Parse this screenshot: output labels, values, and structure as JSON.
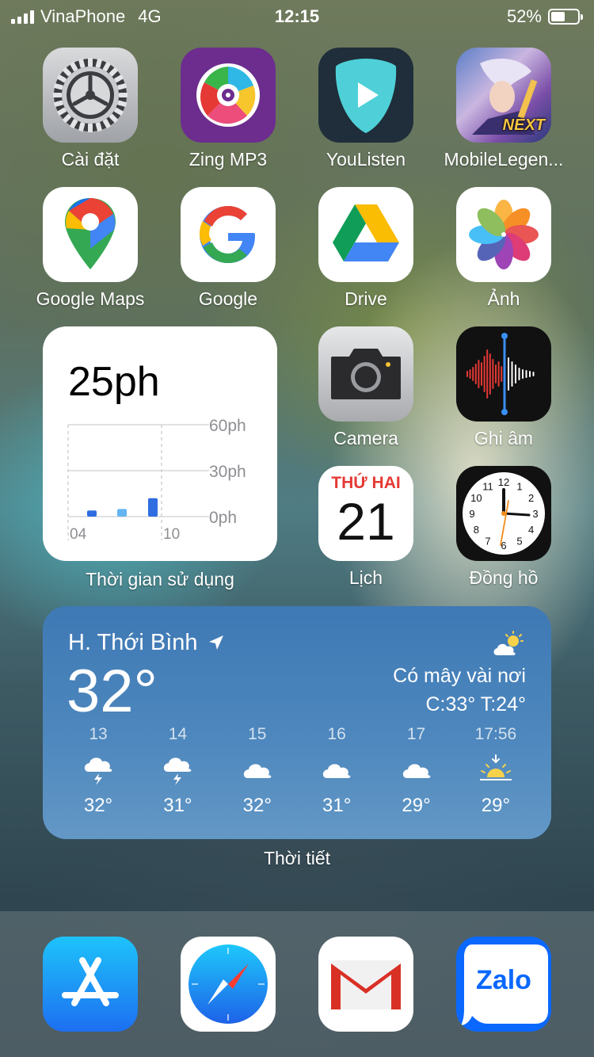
{
  "status_bar": {
    "carrier": "VinaPhone",
    "network": "4G",
    "time": "12:15",
    "battery": "52%",
    "battery_level": 0.52
  },
  "apps": {
    "settings": "Cài đặt",
    "zing": "Zing MP3",
    "youlisten": "YouListen",
    "mobilelegends": "MobileLegen...",
    "mobilelegends_badge": "NEXT",
    "maps": "Google Maps",
    "google": "Google",
    "drive": "Drive",
    "photos": "Ảnh",
    "camera": "Camera",
    "voicememo": "Ghi âm",
    "calendar": "Lịch",
    "calendar_day": "THỨ HAI",
    "calendar_date": "21",
    "clock": "Đồng hồ",
    "clock_numbers": [
      "12",
      "1",
      "2",
      "3",
      "4",
      "5",
      "6",
      "7",
      "8",
      "9",
      "10",
      "11"
    ]
  },
  "screen_time": {
    "label": "Thời gian sử dụng",
    "total": "25ph",
    "chart_data": {
      "type": "bar",
      "y_ticks": [
        "60ph",
        "30ph",
        "0ph"
      ],
      "x_ticks": [
        "04",
        "10"
      ],
      "ylim": [
        0,
        60
      ],
      "bars": [
        {
          "value": 4,
          "color": "#2f6de1"
        },
        {
          "value": 5,
          "color": "#64b5f2"
        },
        {
          "value": 12,
          "color": "#2f6de1"
        }
      ]
    }
  },
  "weather": {
    "label": "Thời tiết",
    "location": "H. Thới Bình",
    "temp": "32°",
    "condition": "Có mây vài nơi",
    "high_low": "C:33° T:24°",
    "hourly": [
      {
        "hour": "13",
        "icon": "thunderstorm-icon",
        "temp": "32°"
      },
      {
        "hour": "14",
        "icon": "thunderstorm-icon",
        "temp": "31°"
      },
      {
        "hour": "15",
        "icon": "cloud-icon",
        "temp": "32°"
      },
      {
        "hour": "16",
        "icon": "cloud-icon",
        "temp": "31°"
      },
      {
        "hour": "17",
        "icon": "cloud-icon",
        "temp": "29°"
      },
      {
        "hour": "17:56",
        "icon": "sunset-icon",
        "temp": "29°"
      }
    ]
  },
  "dock": {
    "zalo": "Zalo"
  }
}
